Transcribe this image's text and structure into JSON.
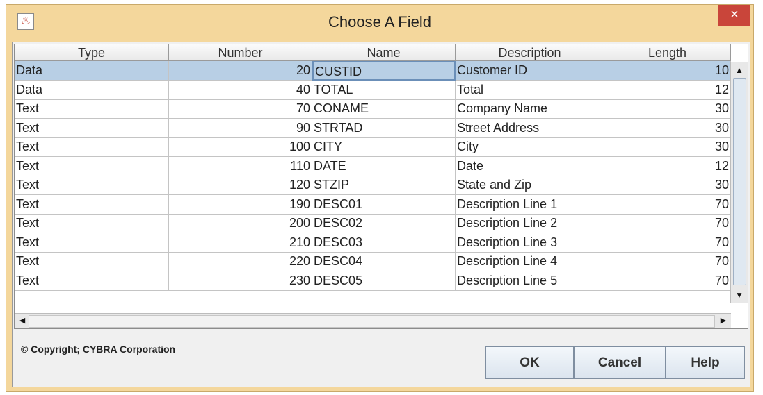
{
  "window": {
    "title": "Choose A Field",
    "close_glyph": "×"
  },
  "table": {
    "headers": [
      "Type",
      "Number",
      "Name",
      "Description",
      "Length"
    ],
    "rows": [
      [
        "Data",
        "20",
        "CUSTID",
        "Customer ID",
        "10"
      ],
      [
        "Data",
        "40",
        "TOTAL",
        "Total",
        "12"
      ],
      [
        "Text",
        "70",
        "CONAME",
        "Company Name",
        "30"
      ],
      [
        "Text",
        "90",
        "STRTAD",
        "Street Address",
        "30"
      ],
      [
        "Text",
        "100",
        "CITY",
        "City",
        "30"
      ],
      [
        "Text",
        "110",
        "DATE",
        "Date",
        "12"
      ],
      [
        "Text",
        "120",
        "STZIP",
        "State and Zip",
        "30"
      ],
      [
        "Text",
        "190",
        "DESC01",
        "Description Line 1",
        "70"
      ],
      [
        "Text",
        "200",
        "DESC02",
        "Description Line 2",
        "70"
      ],
      [
        "Text",
        "210",
        "DESC03",
        "Description Line 3",
        "70"
      ],
      [
        "Text",
        "220",
        "DESC04",
        "Description Line 4",
        "70"
      ],
      [
        "Text",
        "230",
        "DESC05",
        "Description Line 5",
        "70"
      ]
    ],
    "selected_row": 0
  },
  "footer": {
    "copyright": "© Copyright; CYBRA Corporation"
  },
  "buttons": {
    "ok": "OK",
    "cancel": "Cancel",
    "help": "Help"
  },
  "icons": {
    "app": "java-app-icon",
    "close": "close-icon",
    "up": "scroll-up-icon",
    "down": "scroll-down-icon",
    "left": "scroll-left-icon",
    "right": "scroll-right-icon"
  }
}
